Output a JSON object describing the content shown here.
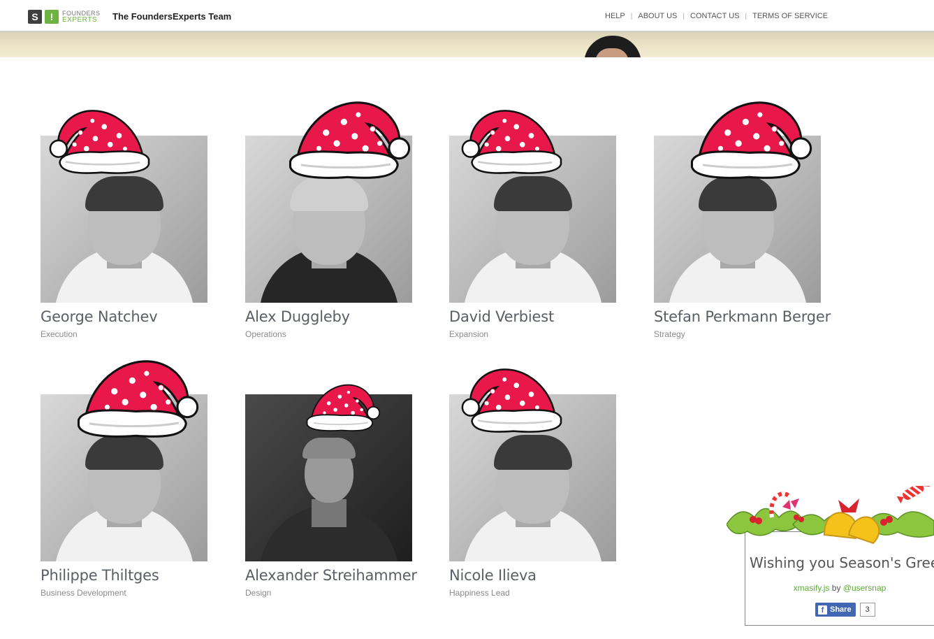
{
  "header": {
    "logo_s": "S",
    "logo_ex": "!",
    "logo_line1": "FOUNDERS",
    "logo_line2": "EXPERTS",
    "site_title": "The FoundersExperts Team",
    "nav": [
      {
        "label": "HELP"
      },
      {
        "label": "ABOUT US"
      },
      {
        "label": "CONTACT US"
      },
      {
        "label": "TERMS OF SERVICE"
      }
    ],
    "separator": "|"
  },
  "team": [
    {
      "name": "George Natchev",
      "role": "Execution"
    },
    {
      "name": "Alex Duggleby",
      "role": "Operations"
    },
    {
      "name": "David Verbiest",
      "role": "Expansion"
    },
    {
      "name": "Stefan Perkmann Berger",
      "role": "Strategy"
    },
    {
      "name": "Philippe Thiltges",
      "role": "Business Development"
    },
    {
      "name": "Alexander Streihammer",
      "role": "Design"
    },
    {
      "name": "Nicole Ilieva",
      "role": "Happiness Lead"
    }
  ],
  "xmas_popup": {
    "title": "Wishing you Season's Greeti",
    "credit_link": "xmasify.js",
    "credit_by": " by ",
    "credit_user": "@usersnap",
    "share_label": "Share",
    "share_icon": "f",
    "share_count": "3"
  },
  "colors": {
    "accent_green": "#6db33f",
    "hat_red": "#e8194a",
    "facebook_blue": "#4267b2"
  },
  "icons": [
    "santa-hat-icon",
    "holly-garland-icon",
    "facebook-icon"
  ]
}
